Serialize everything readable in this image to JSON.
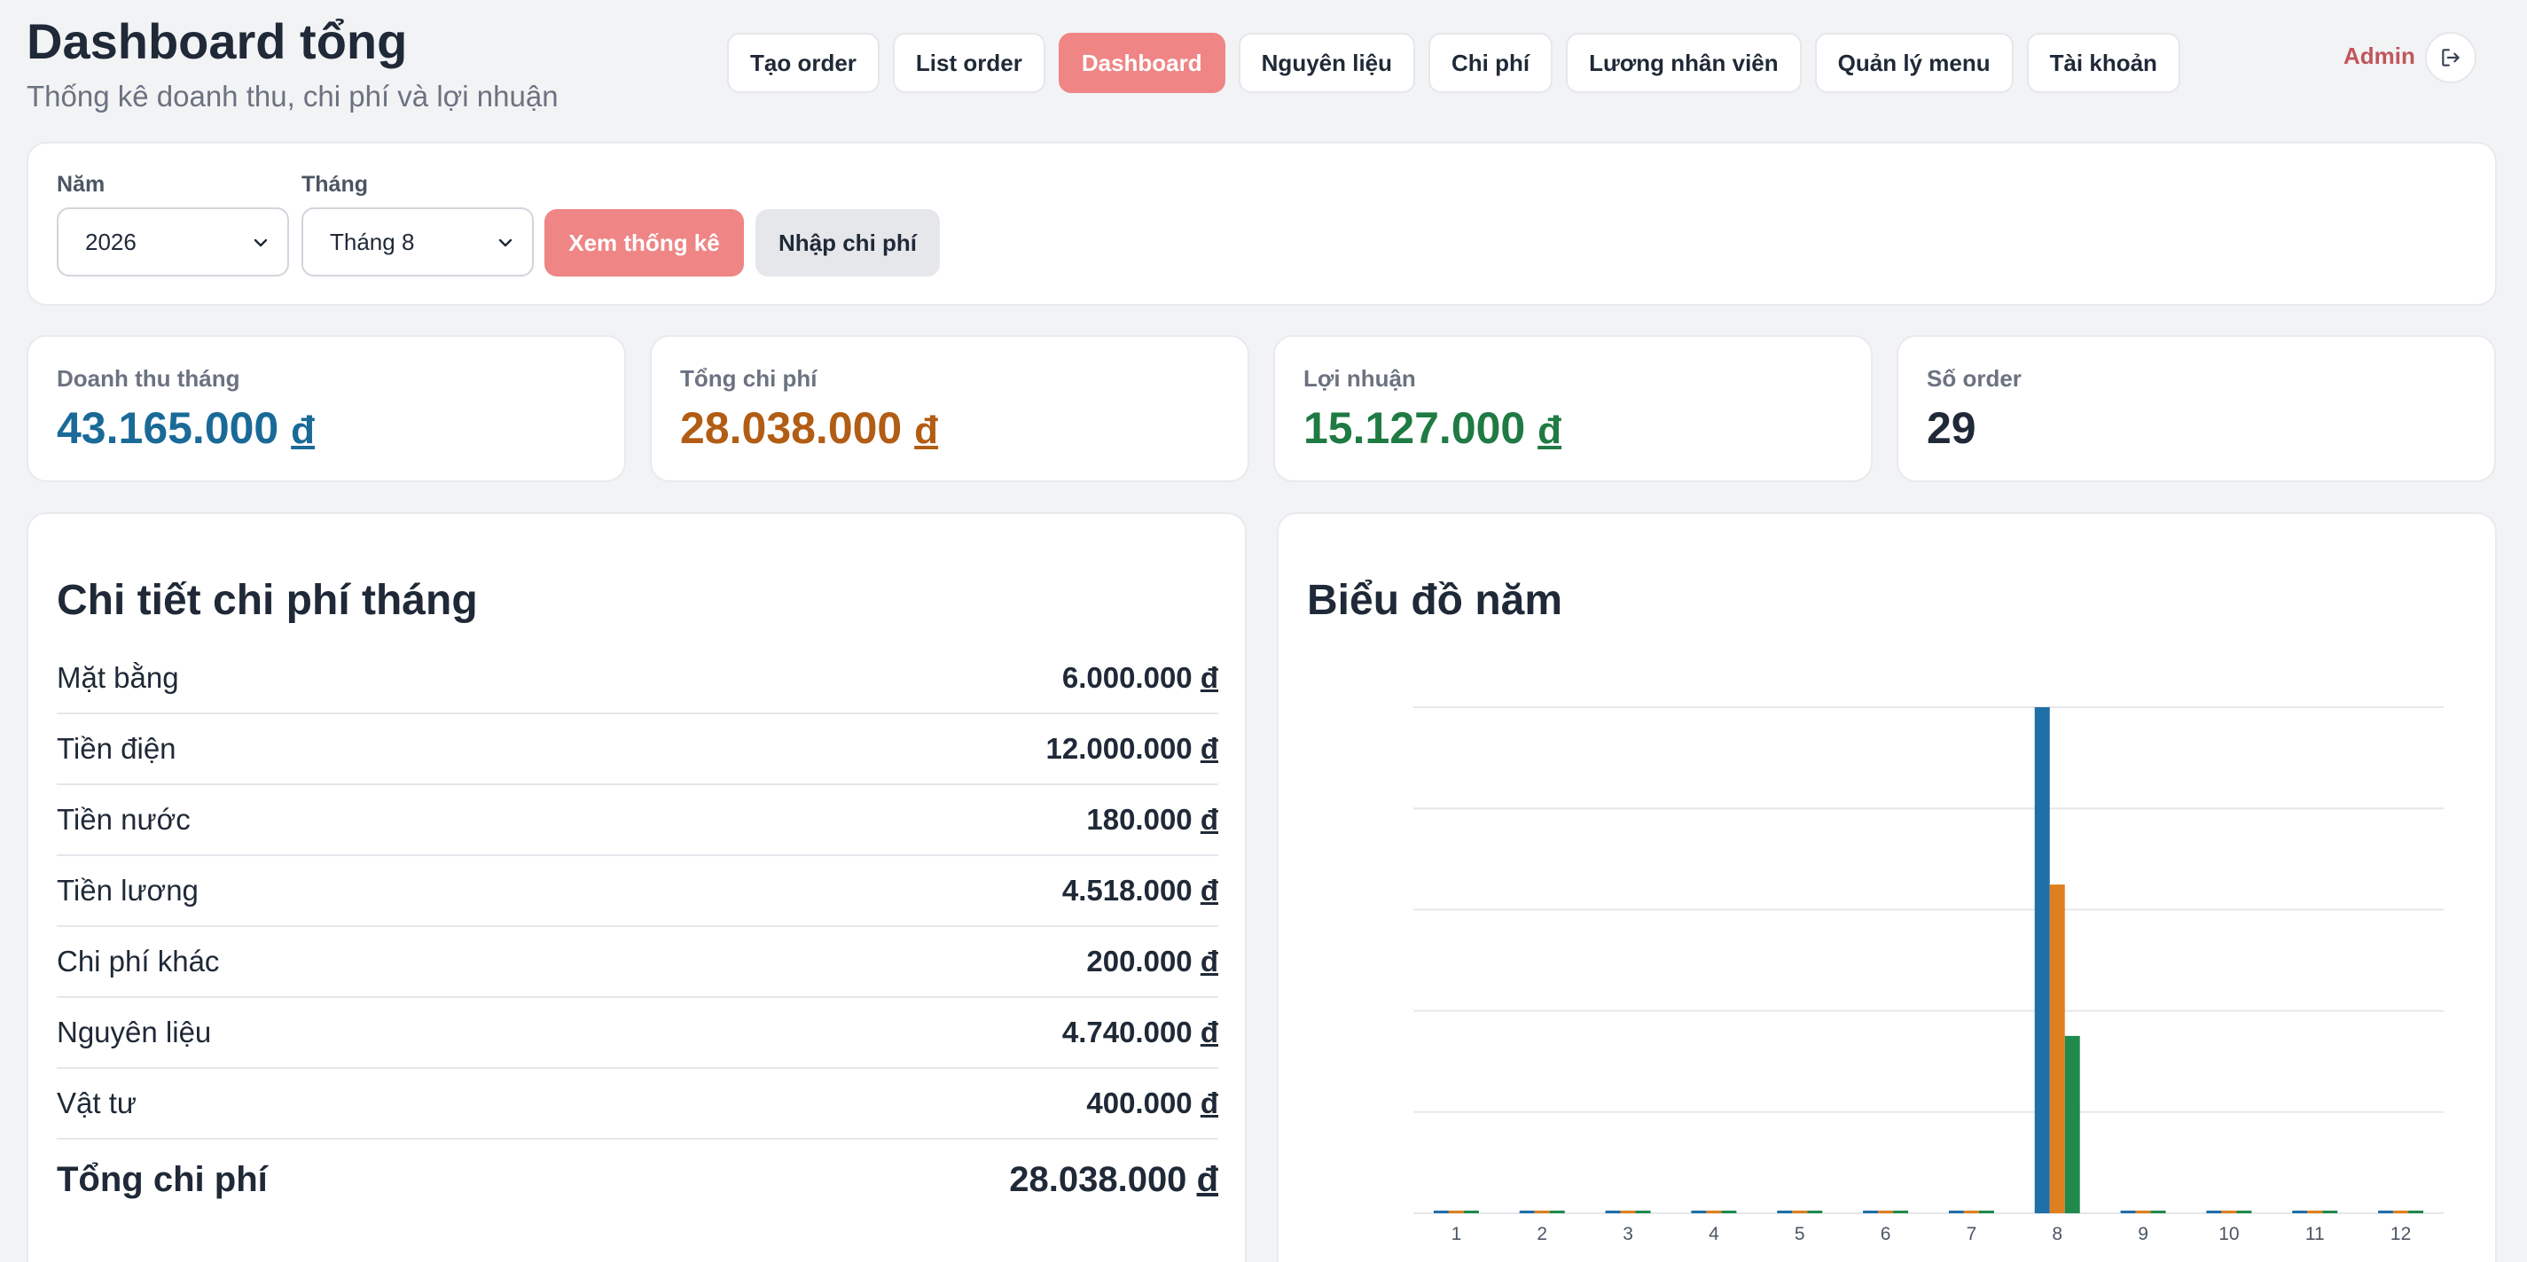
{
  "header": {
    "title": "Dashboard tổng",
    "subtitle": "Thống kê doanh thu, chi phí và lợi nhuận",
    "nav": [
      {
        "label": "Tạo order",
        "active": false
      },
      {
        "label": "List order",
        "active": false
      },
      {
        "label": "Dashboard",
        "active": true
      },
      {
        "label": "Nguyên liệu",
        "active": false
      },
      {
        "label": "Chi phí",
        "active": false
      },
      {
        "label": "Lương nhân viên",
        "active": false
      },
      {
        "label": "Quản lý menu",
        "active": false
      },
      {
        "label": "Tài khoản",
        "active": false
      }
    ],
    "user": "Admin",
    "logout_icon": "logout-icon"
  },
  "filter": {
    "year_label": "Năm",
    "year_value": "2026",
    "month_label": "Tháng",
    "month_value": "Tháng 8",
    "view_button": "Xem thống kê",
    "enter_cost_button": "Nhập chi phí"
  },
  "stats": {
    "revenue": {
      "label": "Doanh thu tháng",
      "value": "43.165.000",
      "currency": "đ",
      "color": "#1a6a98"
    },
    "cost": {
      "label": "Tổng chi phí",
      "value": "28.038.000",
      "currency": "đ",
      "color": "#b25d14"
    },
    "profit": {
      "label": "Lợi nhuận",
      "value": "15.127.000",
      "currency": "đ",
      "color": "#1f7a43"
    },
    "orders": {
      "label": "Số order",
      "value": "29",
      "color": "#1f2937"
    }
  },
  "expenses": {
    "title": "Chi tiết chi phí tháng",
    "items": [
      {
        "name": "Mặt bằng",
        "value": "6.000.000",
        "currency": "đ"
      },
      {
        "name": "Tiền điện",
        "value": "12.000.000",
        "currency": "đ"
      },
      {
        "name": "Tiền nước",
        "value": "180.000",
        "currency": "đ"
      },
      {
        "name": "Tiền lương",
        "value": "4.518.000",
        "currency": "đ"
      },
      {
        "name": "Chi phí khác",
        "value": "200.000",
        "currency": "đ"
      },
      {
        "name": "Nguyên liệu",
        "value": "4.740.000",
        "currency": "đ"
      },
      {
        "name": "Vật tư",
        "value": "400.000",
        "currency": "đ"
      }
    ],
    "total_label": "Tổng chi phí",
    "total_value": "28.038.000",
    "total_currency": "đ"
  },
  "chart_title": "Biểu đồ năm",
  "chart_data": {
    "type": "bar",
    "categories": [
      "1",
      "2",
      "3",
      "4",
      "5",
      "6",
      "7",
      "8",
      "9",
      "10",
      "11",
      "12"
    ],
    "series": [
      {
        "color": "#1f6fa8",
        "values": [
          0,
          0,
          0,
          0,
          0,
          0,
          0,
          43165000,
          0,
          0,
          0,
          0
        ]
      },
      {
        "color": "#e07f1f",
        "values": [
          0,
          0,
          0,
          0,
          0,
          0,
          0,
          28038000,
          0,
          0,
          0,
          0
        ]
      },
      {
        "color": "#1f8a4c",
        "values": [
          0,
          0,
          0,
          0,
          0,
          0,
          0,
          15127000,
          0,
          0,
          0,
          0
        ]
      }
    ],
    "ylim": [
      0,
      43165000
    ],
    "grid": true,
    "title": "Biểu đồ năm"
  }
}
